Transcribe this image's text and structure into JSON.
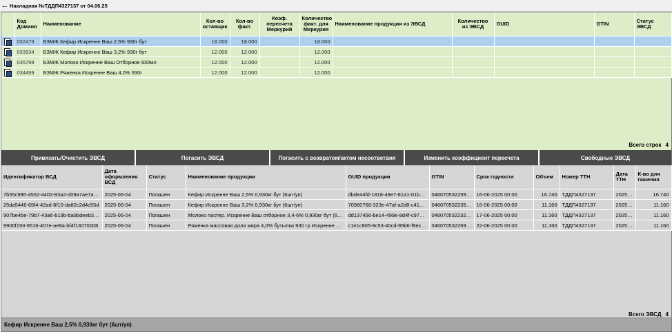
{
  "window": {
    "title": "Накладная №ТДДП4327137 от 04.06.25"
  },
  "top_grid": {
    "headers": [
      "",
      "Код Домино",
      "Наименование",
      "Кол-во оставщик",
      "Кол-во факт.",
      "Коэф. пересчета Меркурий",
      "Количество факт. для Меркурия",
      "Наименование продукции из ЭВСД",
      "Количество из ЭВСД",
      "GUID",
      "GTIN",
      "Статус ЭВСД"
    ],
    "rows": [
      {
        "code": "032479",
        "name": "БЗМЖ Кефир Искренне Ваш 2,5% 930г бут",
        "qty_supplier": "18.000",
        "qty_fact": "18.000",
        "coef": "",
        "qty_merc": "18.000",
        "evsd_name": "",
        "evsd_qty": "",
        "guid": "",
        "gtin": "",
        "status": "",
        "selected": true
      },
      {
        "code": "033934",
        "name": "БЗМЖ Кефир Искренне Ваш 3,2% 930г бут",
        "qty_supplier": "12.000",
        "qty_fact": "12.000",
        "coef": "",
        "qty_merc": "12.000",
        "evsd_name": "",
        "evsd_qty": "",
        "guid": "",
        "gtin": "",
        "status": "",
        "selected": false
      },
      {
        "code": "035798",
        "name": "БЗМЖ Молоко Искренне Ваш Отборное 930мл",
        "qty_supplier": "12.000",
        "qty_fact": "12.000",
        "coef": "",
        "qty_merc": "12.000",
        "evsd_name": "",
        "evsd_qty": "",
        "guid": "",
        "gtin": "",
        "status": "",
        "selected": false
      },
      {
        "code": "034499",
        "name": "БЗМЖ Ряженка Искренне Ваш 4,0% 930г",
        "qty_supplier": "12.000",
        "qty_fact": "12.000",
        "coef": "",
        "qty_merc": "12.000",
        "evsd_name": "",
        "evsd_qty": "",
        "guid": "",
        "gtin": "",
        "status": "",
        "selected": false
      }
    ],
    "total_label": "Всего строк",
    "total_value": "4"
  },
  "buttons": {
    "bind": "Привязать/Очистить ЭВСД",
    "redeem": "Погасить ЭВСД",
    "redeem_return": "Погасить с возвратом/актом несоответвия",
    "change_coef": "Изменить коэффициент пересчета",
    "free": "Свободные ЭВСД"
  },
  "bottom_grid": {
    "headers": [
      "Идентификатор ВСД",
      "Дата оформления ВСД",
      "Статус",
      "Наименование продукции",
      "GUID продукции",
      "GTIN",
      "Срок годности",
      "Объем",
      "Номер ТТН",
      "Дата ТТН",
      "К-во для гашения"
    ],
    "rows": [
      {
        "id": "7b55c986-4552-4402-83a2-d09a7ae7a6b0",
        "date": "2025-06-04",
        "status": "Погашен",
        "name": "Кефир Искренне Ваш 2,5% 0,930кг бут (6шт/уп)",
        "guid": "dbde44fd-1818-49e7-81a1-01b0…",
        "gtin": "04607053225952",
        "expiry": "16-06-2025 00:00",
        "volume": "16.740",
        "ttn": "ТДДП4327137",
        "ttn_date": "2025-…",
        "qty": "16.740"
      },
      {
        "id": "25da5446-65f4-42ad-8f10-da82c2d4c55d",
        "date": "2025-06-04",
        "status": "Погашен",
        "name": "Кефир Искренне Ваш 3,2% 0,930кг бут (6шт/уп)",
        "guid": "70960768-323e-47af-a2d8-c414…",
        "gtin": "04607053223545",
        "expiry": "16-06-2025 00:00",
        "volume": "11.160",
        "ttn": "ТДДП4327137",
        "ttn_date": "2025-…",
        "qty": "11.160"
      },
      {
        "id": "907be4be-79b7-43a6-b19b-ba9bdeeb3971",
        "date": "2025-06-04",
        "status": "Погашен",
        "name": "Молоко пастер. Искренне Ваш отборное 3,4-6% 0,930кг бут (6…",
        "guid": "dd137456-be14-499e-8d4f-c97ef…",
        "gtin": "04607053223200",
        "expiry": "17-06-2025 00:00",
        "volume": "11.160",
        "ttn": "ТДДП4327137",
        "ttn_date": "2025-…",
        "qty": "11.160"
      },
      {
        "id": "9900f193-9516-407e-ae8a-bf4f13070008",
        "date": "2025-06-04",
        "status": "Погашен",
        "name": "Ряженка массовая доля жира 4,0% бутылка 930 гр Искренне В…",
        "guid": "c1e1c805-8c53-40cd-95b6-f9ec…",
        "gtin": "04607053226959",
        "expiry": "22-06-2025 00:00",
        "volume": "11.160",
        "ttn": "ТДДП4327137",
        "ttn_date": "2025-…",
        "qty": "11.160"
      }
    ],
    "total_label": "Всего ЭВСД",
    "total_value": "4"
  },
  "status_bar": {
    "text": "Кефир Искренне Ваш 2,5% 0,930кг бут (6шт/уп)"
  },
  "icons": {
    "back": "arrow-left-icon",
    "row": "document-copy-icon"
  },
  "colors": {
    "top_bg": "#dcedc8",
    "selected_row": "#aecfee",
    "button_bg": "#4a4a4a",
    "bottom_bg": "#d6d6d6",
    "status_bar": "#a6a6a6"
  }
}
